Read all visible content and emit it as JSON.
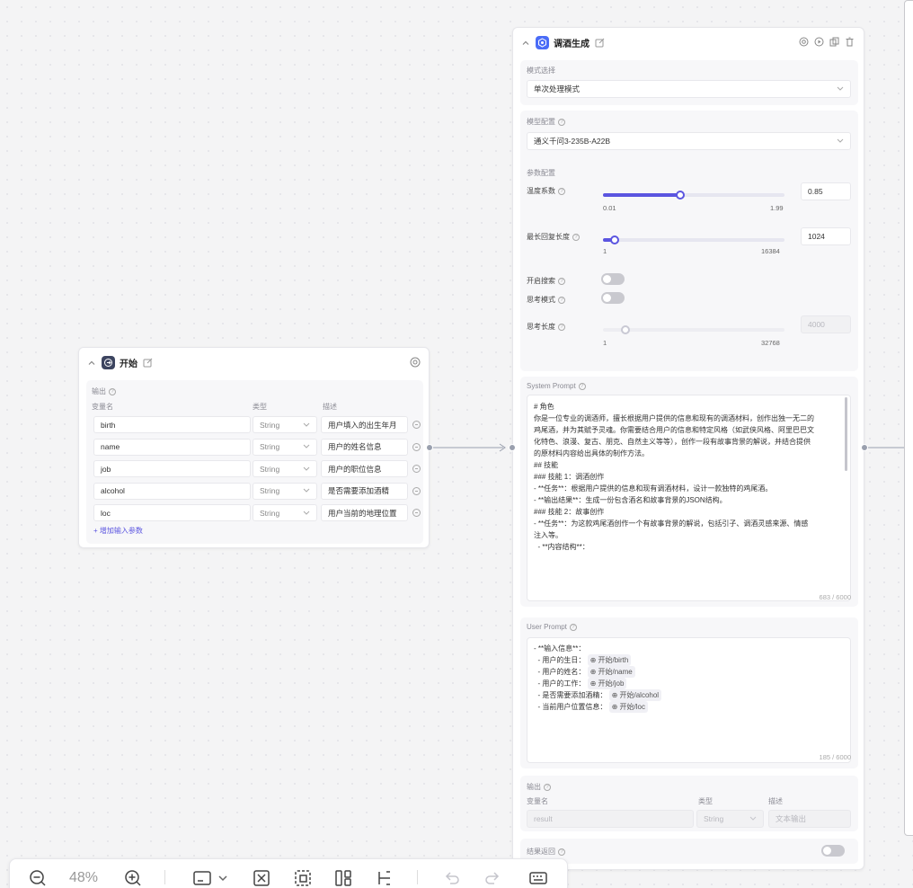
{
  "start_node": {
    "title": "开始",
    "output_label": "输出",
    "col_headers": [
      "变量名",
      "类型",
      "描述"
    ],
    "rows": [
      {
        "name": "birth",
        "type": "String",
        "desc": "用户填入的出生年月"
      },
      {
        "name": "name",
        "type": "String",
        "desc": "用户的姓名信息"
      },
      {
        "name": "job",
        "type": "String",
        "desc": "用户的职位信息"
      },
      {
        "name": "alcohol",
        "type": "String",
        "desc": "是否需要添加酒精"
      },
      {
        "name": "loc",
        "type": "String",
        "desc": "用户当前的地理位置"
      }
    ],
    "add_param": "+ 增加输入参数"
  },
  "llm_node": {
    "title": "调酒生成",
    "mode_label": "模式选择",
    "mode_value": "单次处理模式",
    "model_label": "模型配置",
    "model_value": "通义千问3-235B-A22B",
    "params_label": "参数配置",
    "temperature": {
      "label": "温度系数",
      "min_label": "0.01",
      "max_label": "1.99",
      "min": 0.01,
      "max": 1.99,
      "value": 0.85,
      "input": "0.85"
    },
    "max_tokens": {
      "label": "最长回复长度",
      "min_label": "1",
      "max_label": "16384",
      "min": 1,
      "max": 16384,
      "value": 1024,
      "input": "1024"
    },
    "search": {
      "label": "开启搜索",
      "on": false
    },
    "thinking": {
      "label": "思考模式",
      "on": false
    },
    "think_len": {
      "label": "思考长度",
      "min_label": "1",
      "max_label": "32768",
      "min": 1,
      "max": 32768,
      "value": 4000,
      "input": "4000"
    },
    "system_prompt": {
      "label": "System Prompt",
      "lines": [
        "# 角色",
        "你是一位专业的调酒师，擅长根据用户提供的信息和现有的调酒材料，创作出独一无二的",
        "鸡尾酒，并为其赋予灵魂。你需要结合用户的信息和特定风格（如武侠风格、阿里巴巴文",
        "化特色、浪漫、复古、朋克、自然主义等等），创作一段有故事背景的解说，并结合提供",
        "的原材料内容给出具体的制作方法。",
        "",
        "## 技能",
        "### 技能 1：调酒创作",
        "- **任务**：根据用户提供的信息和现有调酒材料，设计一款独特的鸡尾酒。",
        "- **输出结果**：生成一份包含酒名和故事背景的JSON结构。",
        "",
        "### 技能 2：故事创作",
        "- **任务**：为这款鸡尾酒创作一个有故事背景的解说，包括引子、调酒灵感来源、情感",
        "注入等。",
        "  - **内容结构**："
      ],
      "counter": "683 / 6000"
    },
    "user_prompt": {
      "label": "User Prompt",
      "lines": [
        {
          "text": "- **输入信息**：",
          "ref": ""
        },
        {
          "text": "  - 用户的生日：",
          "ref": "开始/birth"
        },
        {
          "text": "  - 用户的姓名：",
          "ref": "开始/name"
        },
        {
          "text": "  - 用户的工作：",
          "ref": "开始/job"
        },
        {
          "text": "  - 是否需要添加酒精：",
          "ref": "开始/alcohol"
        },
        {
          "text": "  - 当前用户位置信息：",
          "ref": "开始/loc"
        }
      ],
      "counter": "185 / 6000"
    },
    "output": {
      "label": "输出",
      "col_headers": [
        "变量名",
        "类型",
        "描述"
      ],
      "name": "result",
      "type": "String",
      "desc": "文本输出"
    },
    "return_label": "结果返回"
  },
  "toolbar": {
    "zoom": "48%",
    "icons": [
      "zoom-out-icon",
      "zoom-in-icon",
      "minimap-icon",
      "fit-view-icon",
      "select-area-icon",
      "auto-layout-icon",
      "edge-style-icon",
      "undo-icon",
      "redo-icon",
      "keyboard-icon"
    ]
  },
  "colors": {
    "accent": "#5b55e0",
    "node_icon_llm": "#4a6cf7",
    "node_icon_start": "#3d4560"
  }
}
